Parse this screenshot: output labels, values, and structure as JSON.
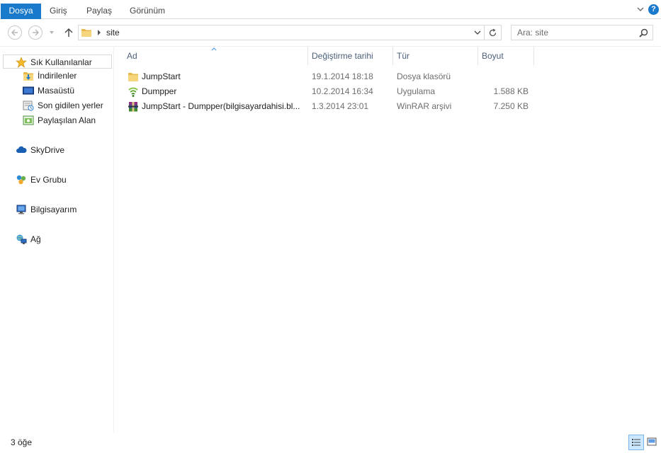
{
  "ribbon": {
    "file_tab": "Dosya",
    "tabs": [
      "Giriş",
      "Paylaş",
      "Görünüm"
    ],
    "help_label": "?"
  },
  "address": {
    "crumb": "site",
    "search_placeholder": "Ara: site"
  },
  "navpane": {
    "favorites": "Sık Kullanılanlar",
    "favorite_items": [
      "İndirilenler",
      "Masaüstü",
      "Son gidilen yerler",
      "Paylaşılan Alan"
    ],
    "groups": [
      "SkyDrive",
      "Ev Grubu",
      "Bilgisayarım",
      "Ağ"
    ]
  },
  "columns": {
    "name": "Ad",
    "date": "Değiştirme tarihi",
    "type": "Tür",
    "size": "Boyut"
  },
  "files": [
    {
      "name": "JumpStart",
      "date": "19.1.2014 18:18",
      "type": "Dosya klasörü",
      "size": "",
      "icon": "folder-icon"
    },
    {
      "name": "Dumpper",
      "date": "10.2.2014 16:34",
      "type": "Uygulama",
      "size": "1.588 KB",
      "icon": "wifi-app-icon"
    },
    {
      "name": "JumpStart - Dumpper(bilgisayardahisi.bl...",
      "date": "1.3.2014 23:01",
      "type": "WinRAR arşivi",
      "size": "7.250 KB",
      "icon": "winrar-archive-icon"
    }
  ],
  "status": {
    "item_count": "3 öğe"
  },
  "colors": {
    "accent": "#1979ca",
    "header_text": "#4c607a",
    "folder": "#e8b94a"
  }
}
